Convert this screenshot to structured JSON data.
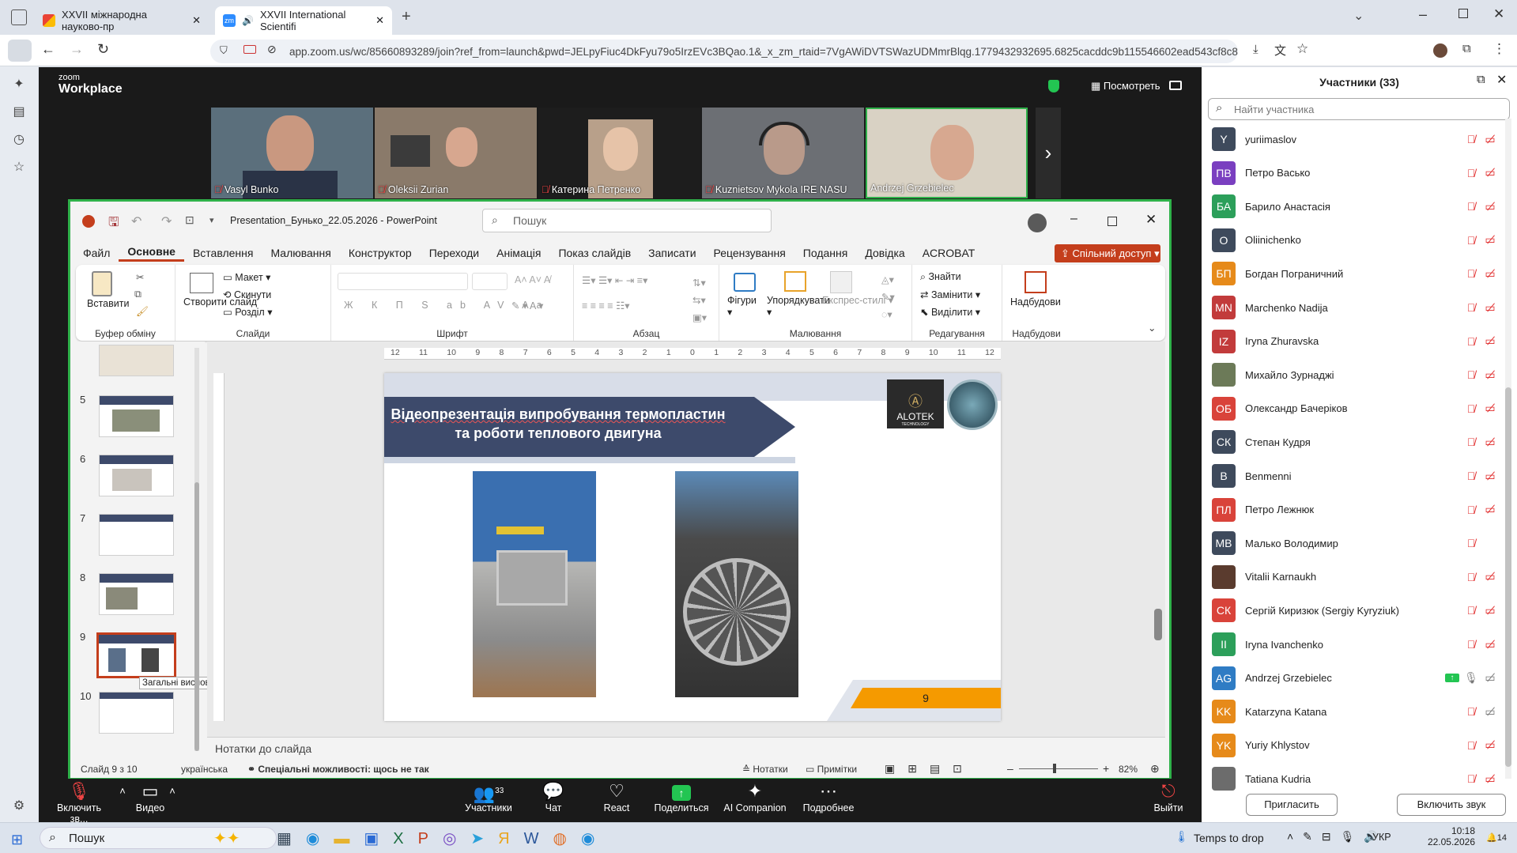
{
  "browser": {
    "tabs": [
      {
        "label": "XXVII міжнародна науково-пр",
        "active": false
      },
      {
        "label": "XXVII International Scientifi",
        "active": true
      }
    ],
    "url": "app.zoom.us/wc/85660893289/join?ref_from=launch&pwd=JELpyFiuc4DkFyu79o5IrzEVc3BQao.1&_x_zm_rtaid=7VgAWiDVTSWazUDMmrBlqg.1779432932695.6825cacddc9b115546602ead543cf8c8&"
  },
  "zoom": {
    "brand_top": "zoom",
    "brand_bottom": "Workplace",
    "view_label": "Посмотреть",
    "videos": [
      {
        "name": "Vasyl Bunko"
      },
      {
        "name": "Oleksii Zurian"
      },
      {
        "name": "Катерина Петренко"
      },
      {
        "name": "Kuznietsov Mykola IRE NASU"
      },
      {
        "name": "Andrzej Grzebielec"
      }
    ],
    "toolbar": {
      "mic": "Включить зв...",
      "video": "Видео",
      "participants": "Участники",
      "participants_count": "33",
      "chat": "Чат",
      "react": "React",
      "share": "Поделиться",
      "ai": "AI Companion",
      "more": "Подробнее",
      "leave": "Выйти"
    }
  },
  "ppt": {
    "filename": "Presentation_Бунько_22.05.2026 - PowerPoint",
    "search_placeholder": "Пошук",
    "menu": [
      "Файл",
      "Основне",
      "Вставлення",
      "Малювання",
      "Конструктор",
      "Переходи",
      "Анімація",
      "Показ слайдів",
      "Записати",
      "Рецензування",
      "Подання",
      "Довідка",
      "ACROBAT"
    ],
    "share_btn": "Спільний доступ",
    "ribbon": {
      "paste": "Вставити",
      "clipboard": "Буфер обміну",
      "new_slide": "Створити слайд",
      "layout": "Макет",
      "reset": "Скинути",
      "section": "Розділ",
      "slides": "Слайди",
      "font": "Шрифт",
      "paragraph": "Абзац",
      "shapes": "Фігури",
      "arrange": "Упорядкувати",
      "quick_styles": "Експрес-стилі",
      "drawing": "Малювання",
      "find": "Знайти",
      "replace": "Замінити",
      "select": "Виділити",
      "editing": "Редагування",
      "addins": "Надбудови",
      "addins_group": "Надбудови"
    },
    "slide_numbers": [
      "5",
      "6",
      "7",
      "8",
      "9",
      "10"
    ],
    "tooltip": "Загальні висновки",
    "ruler": [
      "12",
      "11",
      "10",
      "9",
      "8",
      "7",
      "6",
      "5",
      "4",
      "3",
      "2",
      "1",
      "0",
      "1",
      "2",
      "3",
      "4",
      "5",
      "6",
      "7",
      "8",
      "9",
      "10",
      "11",
      "12"
    ],
    "slide": {
      "title_line1": "Відеопрезентація випробування термопластин",
      "title_line2": "та роботи теплового двигуна",
      "logo_text": "ALOTEK",
      "logo_sub": "TECHNOLOGY",
      "page_number": "9"
    },
    "notes_placeholder": "Нотатки до слайда",
    "status": {
      "slide_info": "Слайд 9 з 10",
      "lang": "українська",
      "accessibility": "Спеціальні можливості: щось не так",
      "notes": "Нотатки",
      "comments": "Примітки",
      "zoom": "82%"
    }
  },
  "participants": {
    "title": "Участники (33)",
    "search_placeholder": "Найти участника",
    "list": [
      {
        "initials": "Y",
        "name": "yuriimaslov",
        "color": "#3e4a5c"
      },
      {
        "initials": "ПВ",
        "name": "Петро Васько",
        "color": "#7a3fc0"
      },
      {
        "initials": "БА",
        "name": "Барило Анастасія",
        "color": "#2c9f5a"
      },
      {
        "initials": "O",
        "name": "Oliinichenko",
        "color": "#3e4a5c"
      },
      {
        "initials": "БП",
        "name": "Богдан Пограничний",
        "color": "#e68a1a"
      },
      {
        "initials": "MN",
        "name": "Marchenko Nadija",
        "color": "#c23b3b"
      },
      {
        "initials": "IZ",
        "name": "Iryna Zhuravska",
        "color": "#c23b3b"
      },
      {
        "initials": "",
        "name": "Михайло Зурнаджі",
        "color": "#6c7a58"
      },
      {
        "initials": "ОБ",
        "name": "Олександр Бачеріков",
        "color": "#d9433a"
      },
      {
        "initials": "СК",
        "name": "Степан Кудря",
        "color": "#3e4a5c"
      },
      {
        "initials": "B",
        "name": "Benmenni",
        "color": "#3e4a5c"
      },
      {
        "initials": "ПЛ",
        "name": "Петро Лежнюк",
        "color": "#d9433a"
      },
      {
        "initials": "МВ",
        "name": "Малько Володимир",
        "color": "#3e4a5c"
      },
      {
        "initials": "",
        "name": "Vitalii Karnaukh",
        "color": "#5a3b2e"
      },
      {
        "initials": "СК",
        "name": "Сергій Киризюк (Sergiy Kyryziuk)",
        "color": "#d9433a"
      },
      {
        "initials": "II",
        "name": "Iryna Ivanchenko",
        "color": "#2c9f5a"
      },
      {
        "initials": "AG",
        "name": "Andrzej Grzebielec",
        "color": "#2f7cc4"
      },
      {
        "initials": "KK",
        "name": "Katarzyna Katana",
        "color": "#e68a1a"
      },
      {
        "initials": "YK",
        "name": "Yuriy Khlystov",
        "color": "#e68a1a"
      },
      {
        "initials": "",
        "name": "Tatiana Kudria",
        "color": "#6c6c6c"
      }
    ],
    "invite": "Пригласить",
    "unmute": "Включить звук"
  },
  "taskbar": {
    "search": "Пошук",
    "weather": "Temps to drop",
    "lang": "УКР",
    "time": "10:18",
    "date": "22.05.2026",
    "badge": "14"
  },
  "colors": {
    "zoom_bg": "#1a1a1a",
    "share_border": "#2fb14a",
    "ppt_red": "#c43e1c",
    "slide_navy": "#3d4a6b",
    "slide_orange": "#f59a00"
  }
}
